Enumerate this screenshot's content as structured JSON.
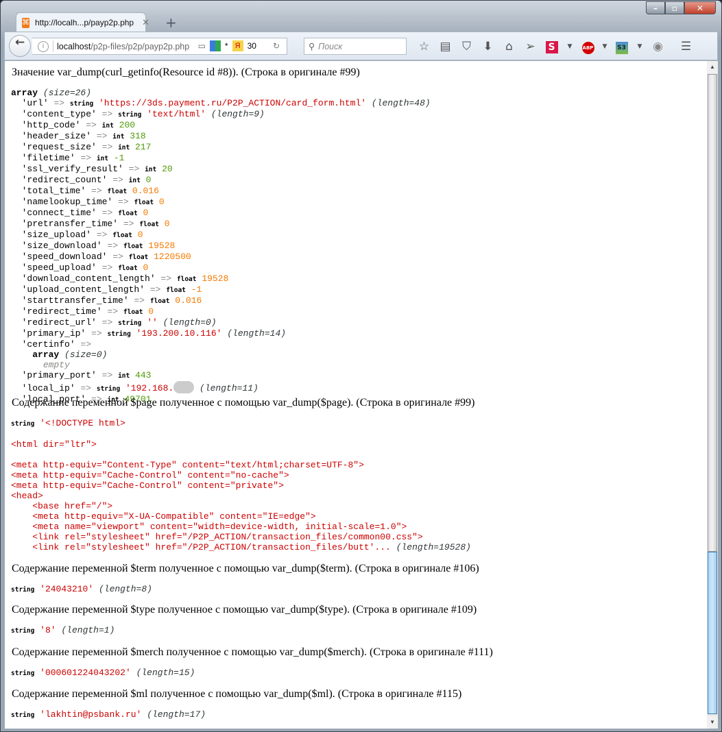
{
  "browser": {
    "tab_title": "http://localh...p/payp2p.php",
    "url_host": "localhost",
    "url_path": "/p2p-files/p2p/payp2p.php",
    "yandex_count": "30",
    "asterisk": "*",
    "search_placeholder": "Поиск",
    "toolbar_icons": [
      "bookmark-star-icon",
      "reading-list-icon",
      "pocket-icon",
      "download-icon",
      "home-icon",
      "send-icon",
      "s-extension-icon",
      "adblock-plus-icon",
      "s3-extension-icon",
      "eye-extension-icon",
      "menu-icon"
    ]
  },
  "dump1": {
    "heading": "Значение var_dump(curl_getinfo(Resource id #8)). (Строка в оригинале #99)",
    "array_label": "array",
    "array_size": "(size=26)",
    "entries": [
      {
        "key": "'url'",
        "type": "string",
        "value": "'https://3ds.payment.ru/P2P_ACTION/card_form.html'",
        "extra": "(length=48)"
      },
      {
        "key": "'content_type'",
        "type": "string",
        "value": "'text/html'",
        "extra": "(length=9)"
      },
      {
        "key": "'http_code'",
        "type": "int",
        "value": "200"
      },
      {
        "key": "'header_size'",
        "type": "int",
        "value": "318"
      },
      {
        "key": "'request_size'",
        "type": "int",
        "value": "217"
      },
      {
        "key": "'filetime'",
        "type": "int",
        "value": "-1"
      },
      {
        "key": "'ssl_verify_result'",
        "type": "int",
        "value": "20"
      },
      {
        "key": "'redirect_count'",
        "type": "int",
        "value": "0"
      },
      {
        "key": "'total_time'",
        "type": "float",
        "value": "0.016"
      },
      {
        "key": "'namelookup_time'",
        "type": "float",
        "value": "0"
      },
      {
        "key": "'connect_time'",
        "type": "float",
        "value": "0"
      },
      {
        "key": "'pretransfer_time'",
        "type": "float",
        "value": "0"
      },
      {
        "key": "'size_upload'",
        "type": "float",
        "value": "0"
      },
      {
        "key": "'size_download'",
        "type": "float",
        "value": "19528"
      },
      {
        "key": "'speed_download'",
        "type": "float",
        "value": "1220500"
      },
      {
        "key": "'speed_upload'",
        "type": "float",
        "value": "0"
      },
      {
        "key": "'download_content_length'",
        "type": "float",
        "value": "19528"
      },
      {
        "key": "'upload_content_length'",
        "type": "float",
        "value": "-1"
      },
      {
        "key": "'starttransfer_time'",
        "type": "float",
        "value": "0.016"
      },
      {
        "key": "'redirect_time'",
        "type": "float",
        "value": "0"
      },
      {
        "key": "'redirect_url'",
        "type": "string",
        "value": "''",
        "extra": "(length=0)"
      },
      {
        "key": "'primary_ip'",
        "type": "string",
        "value": "'193.200.10.116'",
        "extra": "(length=14)"
      }
    ],
    "certinfo": {
      "key": "'certinfo'",
      "array_label": "array",
      "size": "(size=0)",
      "empty": "empty"
    },
    "entries2": [
      {
        "key": "'primary_port'",
        "type": "int",
        "value": "443"
      },
      {
        "key": "'local_ip'",
        "type": "string",
        "value": "'192.168.",
        "extra": "(length=11)",
        "redacted": true
      },
      {
        "key": "'local_port'",
        "type": "int",
        "value": "49701"
      }
    ]
  },
  "dump2": {
    "heading": "Содержание переменной $page полученное с помощью var_dump($page). (Строка в оригинале #99)",
    "type": "string",
    "lines": [
      "'<!DOCTYPE html>",
      "",
      "<html dir=\"ltr\">",
      "",
      "<meta http-equiv=\"Content-Type\" content=\"text/html;charset=UTF-8\">",
      "<meta http-equiv=\"Cache-Control\" content=\"no-cache\">",
      "<meta http-equiv=\"Cache-Control\" content=\"private\">",
      "<head>",
      "    <base href=\"/\">",
      "    <meta http-equiv=\"X-UA-Compatible\" content=\"IE=edge\">",
      "    <meta name=\"viewport\" content=\"width=device-width, initial-scale=1.0\">",
      "    <link rel=\"stylesheet\" href=\"/P2P_ACTION/transaction_files/common00.css\">",
      "    <link rel=\"stylesheet\" href=\"/P2P_ACTION/transaction_files/butt'..."
    ],
    "extra": "(length=19528)"
  },
  "dumps": [
    {
      "heading": "Содержание переменной $term полученное с помощью var_dump($term). (Строка в оригинале #106)",
      "type": "string",
      "value": "'24043210'",
      "extra": "(length=8)"
    },
    {
      "heading": "Содержание переменной $type полученное с помощью var_dump($type). (Строка в оригинале #109)",
      "type": "string",
      "value": "'8'",
      "extra": "(length=1)"
    },
    {
      "heading": "Содержание переменной $merch полученное с помощью var_dump($merch). (Строка в оригинале #111)",
      "type": "string",
      "value": "'000601224043202'",
      "extra": "(length=15)"
    },
    {
      "heading": "Содержание переменной $ml полученное с помощью var_dump($ml). (Строка в оригинале #115)",
      "type": "string",
      "value": "'lakhtin@psbank.ru'",
      "extra": "(length=17)"
    }
  ]
}
